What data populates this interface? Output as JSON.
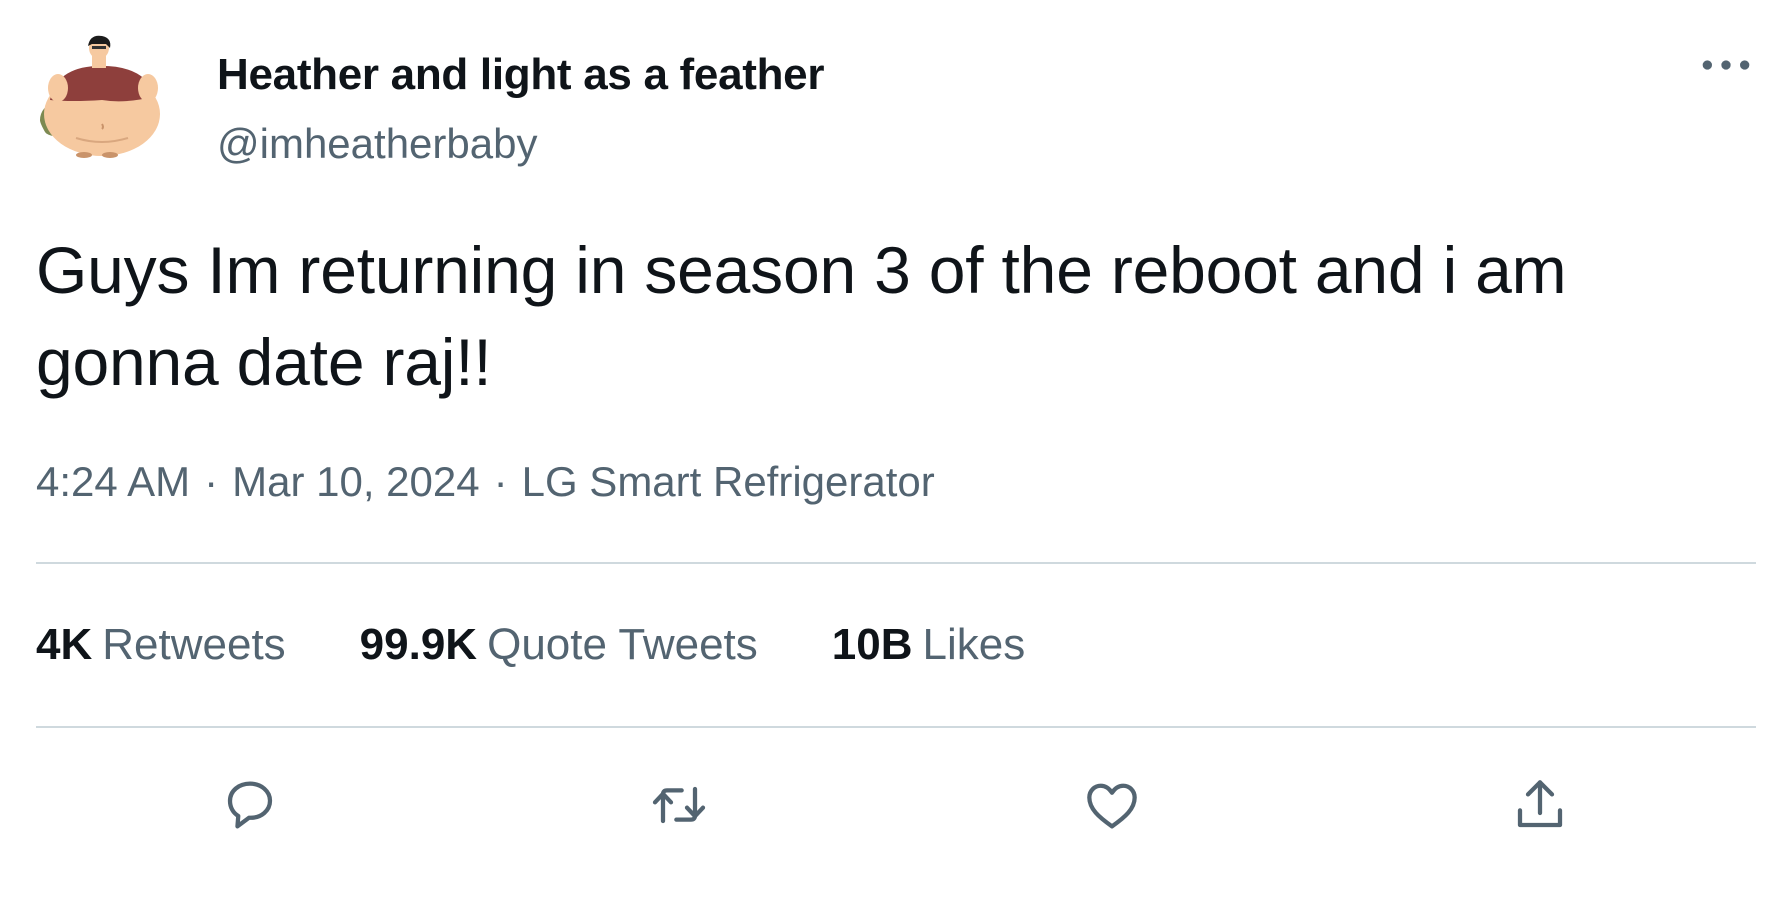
{
  "user": {
    "display_name": "Heather and light as a feather",
    "handle": "@imheatherbaby",
    "avatar_icon": "cartoon-avatar"
  },
  "tweet": {
    "text": "Guys Im returning in season 3 of the reboot and i am gonna date raj!!",
    "time": "4:24 AM",
    "date": "Mar 10, 2024",
    "source": "LG Smart Refrigerator",
    "separator": "·"
  },
  "stats": {
    "retweets_count": "4K",
    "retweets_label": "Retweets",
    "quotes_count": "99.9K",
    "quotes_label": "Quote Tweets",
    "likes_count": "10B",
    "likes_label": "Likes"
  },
  "actions": {
    "reply_icon": "reply-icon",
    "retweet_icon": "retweet-icon",
    "like_icon": "heart-icon",
    "share_icon": "share-icon",
    "more_icon": "more-icon"
  },
  "colors": {
    "text_primary": "#0f1419",
    "text_secondary": "#536471",
    "divider": "#cfd9de"
  }
}
